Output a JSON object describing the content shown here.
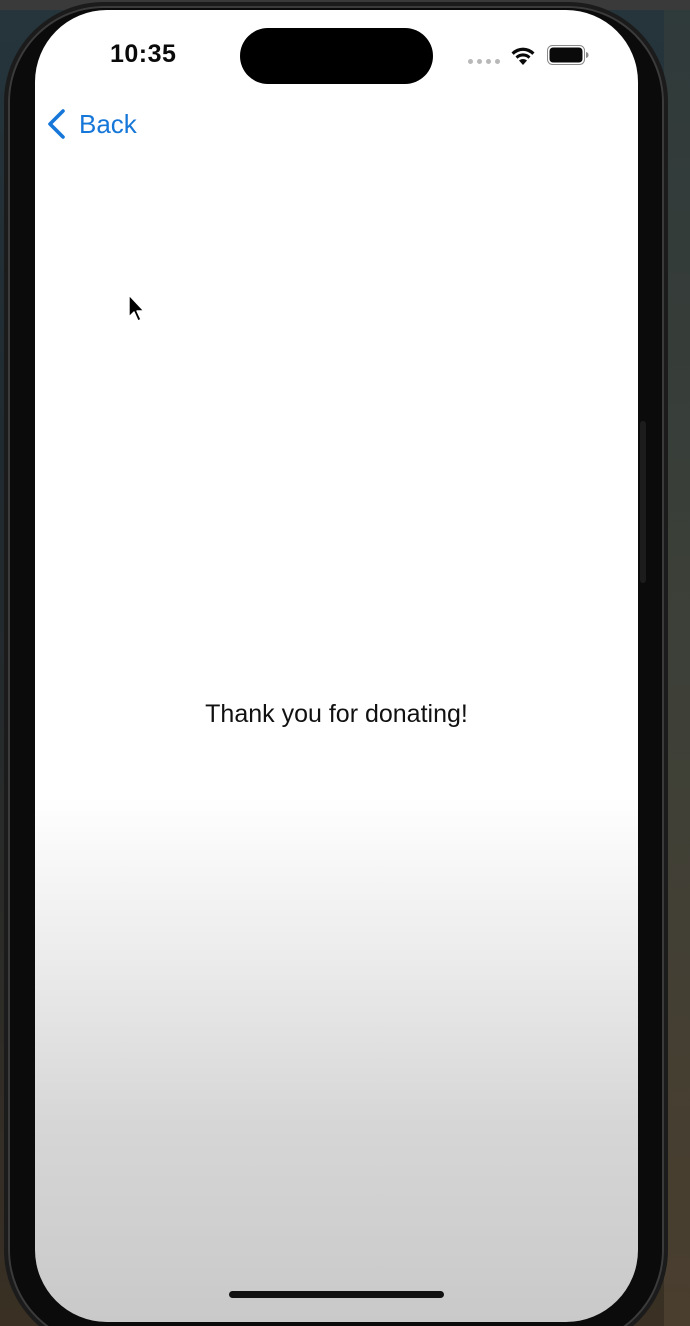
{
  "status_bar": {
    "time": "10:35",
    "icons": [
      "cellular-signal-icon",
      "wifi-icon",
      "battery-icon"
    ]
  },
  "nav": {
    "back_label": "Back",
    "back_icon": "chevron-left-icon"
  },
  "main": {
    "message": "Thank you for donating!"
  },
  "colors": {
    "accent": "#1677d9",
    "text": "#111111",
    "screen_bg": "#ffffff"
  }
}
